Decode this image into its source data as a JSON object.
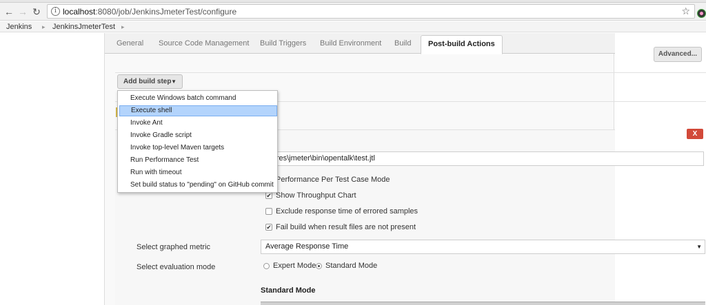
{
  "browser": {
    "url_host": "localhost",
    "url_rest": ":8080/job/JenkinsJmeterTest/configure"
  },
  "breadcrumb": {
    "items": [
      "Jenkins",
      "JenkinsJmeterTest"
    ]
  },
  "tabs": [
    "General",
    "Source Code Management",
    "Build Triggers",
    "Build Environment",
    "Build",
    "Post-build Actions"
  ],
  "toolbar": {
    "advanced_label": "Advanced...",
    "add_build_step_label": "Add build step"
  },
  "build_step_menu": {
    "items": [
      "Execute Windows batch command",
      "Execute shell",
      "Invoke Ant",
      "Invoke Gradle script",
      "Invoke top-level Maven targets",
      "Run Performance Test",
      "Run with timeout",
      "Set build status to \"pending\" on GitHub commit"
    ],
    "highlighted": "Execute shell"
  },
  "performance": {
    "delete_label": "X",
    "report_path": "C:\\softwares\\jmeter\\bin\\opentalk\\test.jtl",
    "checkboxes": [
      {
        "label": "Performance Per Test Case Mode",
        "checked": false
      },
      {
        "label": "Show Throughput Chart",
        "checked": true
      },
      {
        "label": "Exclude response time of errored samples",
        "checked": false
      },
      {
        "label": "Fail build when result files are not present",
        "checked": true
      }
    ],
    "graphed_metric_label": "Select graphed metric",
    "graphed_metric_value": "Average Response Time",
    "evaluation_mode_label": "Select evaluation mode",
    "mode_expert": "Expert Mode",
    "mode_standard": "Standard Mode",
    "selected_mode": "Standard Mode",
    "standard_mode_heading": "Standard Mode"
  },
  "colors": {
    "delete_red": "#d24939",
    "menu_highlight": "#b3d4fc"
  }
}
